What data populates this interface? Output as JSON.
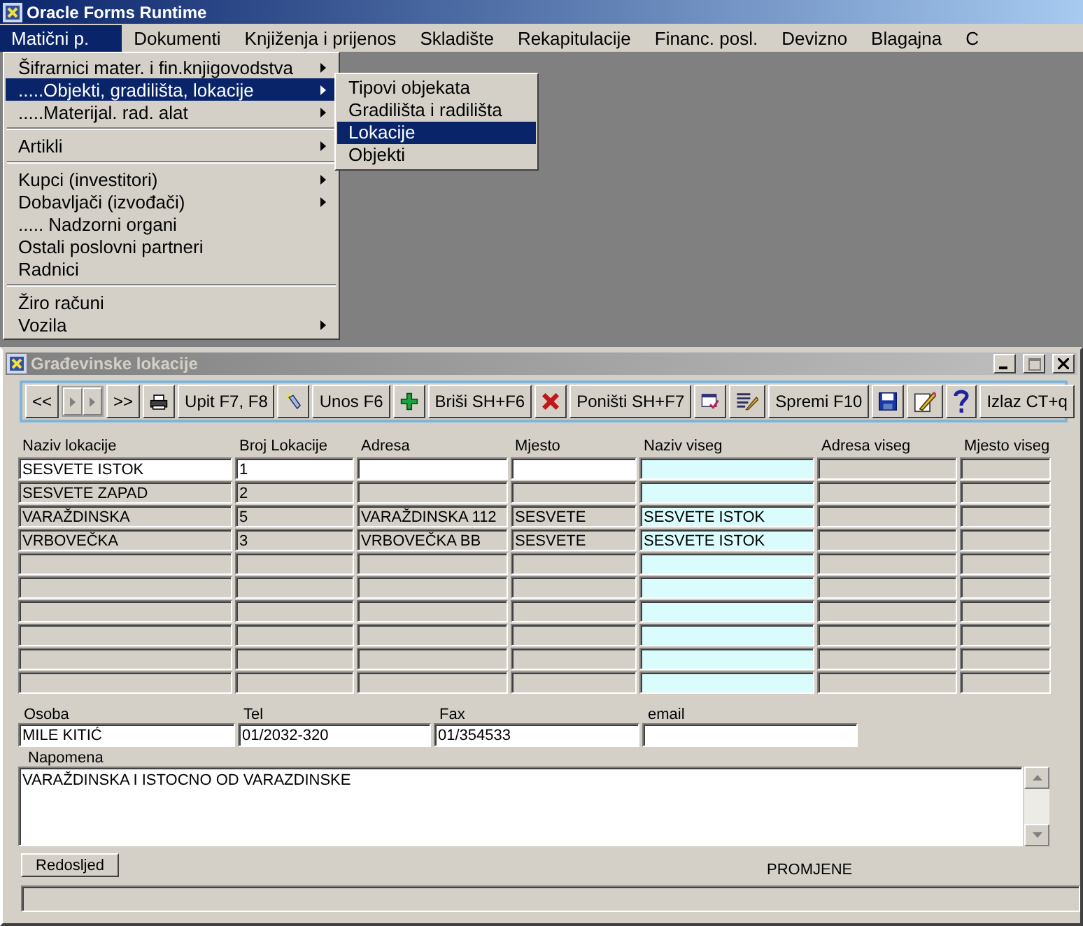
{
  "window": {
    "title": "Oracle Forms Runtime"
  },
  "menubar": [
    {
      "label": "Matični p.",
      "selected": true
    },
    {
      "label": "Dokumenti",
      "selected": false
    },
    {
      "label": "Knjiženja i prijenos",
      "selected": false
    },
    {
      "label": "Skladište",
      "selected": false
    },
    {
      "label": "Rekapitulacije",
      "selected": false
    },
    {
      "label": "Financ. posl.",
      "selected": false
    },
    {
      "label": "Devizno",
      "selected": false
    },
    {
      "label": "Blagajna",
      "selected": false
    },
    {
      "label": "C",
      "selected": false
    }
  ],
  "menu": {
    "items": [
      {
        "kind": "item",
        "label": "Šifrarnici mater. i fin.knjigovodstva",
        "submenu": true,
        "selected": false
      },
      {
        "kind": "item",
        "label": ".....Objekti, gradilišta, lokacije",
        "submenu": true,
        "selected": true
      },
      {
        "kind": "item",
        "label": ".....Materijal. rad. alat",
        "submenu": true,
        "selected": false
      },
      {
        "kind": "separator"
      },
      {
        "kind": "item",
        "label": "Artikli",
        "submenu": true,
        "selected": false
      },
      {
        "kind": "separator"
      },
      {
        "kind": "item",
        "label": "Kupci (investitori)",
        "submenu": true,
        "selected": false
      },
      {
        "kind": "item",
        "label": "Dobavljači (izvođači)",
        "submenu": true,
        "selected": false
      },
      {
        "kind": "item",
        "label": "..... Nadzorni organi",
        "submenu": false,
        "selected": false
      },
      {
        "kind": "item",
        "label": "Ostali poslovni partneri",
        "submenu": false,
        "selected": false
      },
      {
        "kind": "item",
        "label": "Radnici",
        "submenu": false,
        "selected": false
      },
      {
        "kind": "separator"
      },
      {
        "kind": "item",
        "label": "Žiro računi",
        "submenu": false,
        "selected": false
      },
      {
        "kind": "item",
        "label": "Vozila",
        "submenu": true,
        "selected": false
      }
    ]
  },
  "submenu": {
    "items": [
      {
        "label": "Tipovi objekata",
        "selected": false
      },
      {
        "label": "Gradilišta i radilišta",
        "selected": false
      },
      {
        "label": "Lokacije",
        "selected": true
      },
      {
        "label": "Objekti",
        "selected": false
      }
    ]
  },
  "form": {
    "title": "Građevinske lokacije",
    "toolbar": [
      {
        "kind": "text",
        "label": "<<"
      },
      {
        "kind": "scroller"
      },
      {
        "kind": "text",
        "label": ">>"
      },
      {
        "kind": "printer"
      },
      {
        "kind": "text",
        "label": "Upit F7, F8"
      },
      {
        "kind": "flashlight"
      },
      {
        "kind": "text",
        "label": "Unos F6"
      },
      {
        "kind": "plus"
      },
      {
        "kind": "text",
        "label": "Briši SH+F6"
      },
      {
        "kind": "cross"
      },
      {
        "kind": "text",
        "label": "Poništi SH+F7"
      },
      {
        "kind": "form-check"
      },
      {
        "kind": "list-pencil"
      },
      {
        "kind": "text",
        "label": "Spremi F10"
      },
      {
        "kind": "disk"
      },
      {
        "kind": "note-pencil"
      },
      {
        "kind": "help"
      },
      {
        "kind": "text",
        "label": "Izlaz CT+q"
      }
    ],
    "table": {
      "columns": [
        {
          "label": "Naziv lokacije",
          "kind": "input"
        },
        {
          "label": "Broj Lokacije",
          "kind": "input"
        },
        {
          "label": "Adresa",
          "kind": "input"
        },
        {
          "label": "Mjesto",
          "kind": "input"
        },
        {
          "label": "Naziv viseg",
          "kind": "lookup"
        },
        {
          "label": "Adresa viseg",
          "kind": "readonly"
        },
        {
          "label": "Mjesto viseg",
          "kind": "readonly"
        }
      ],
      "rows": [
        {
          "selected": true,
          "cells": [
            "SESVETE ISTOK",
            "1"
          ]
        },
        {
          "selected": false,
          "cells": [
            "SESVETE ZAPAD",
            "2"
          ]
        },
        {
          "selected": false,
          "cells": [
            "VARAŽDINSKA",
            "5",
            "VARAŽDINSKA 112",
            "SESVETE",
            "SESVETE ISTOK"
          ]
        },
        {
          "selected": false,
          "cells": [
            "VRBOVEČKA",
            "3",
            "VRBOVEČKA BB",
            "SESVETE",
            "SESVETE ISTOK"
          ]
        },
        {
          "selected": false
        },
        {
          "selected": false
        },
        {
          "selected": false
        },
        {
          "selected": false
        },
        {
          "selected": false
        },
        {
          "selected": false
        }
      ]
    },
    "fields": [
      {
        "label": "Osoba",
        "value": "MILE KITIĆ"
      },
      {
        "label": "Tel",
        "value": "01/2032-320"
      },
      {
        "label": "Fax",
        "value": "01/354533"
      },
      {
        "label": "email"
      }
    ],
    "note": {
      "label": "Napomena",
      "value": "VARAŽDINSKA I ISTOCNO OD VARAZDINSKE"
    },
    "order_button": "Redosljed",
    "status_label": "PROMJENE"
  }
}
